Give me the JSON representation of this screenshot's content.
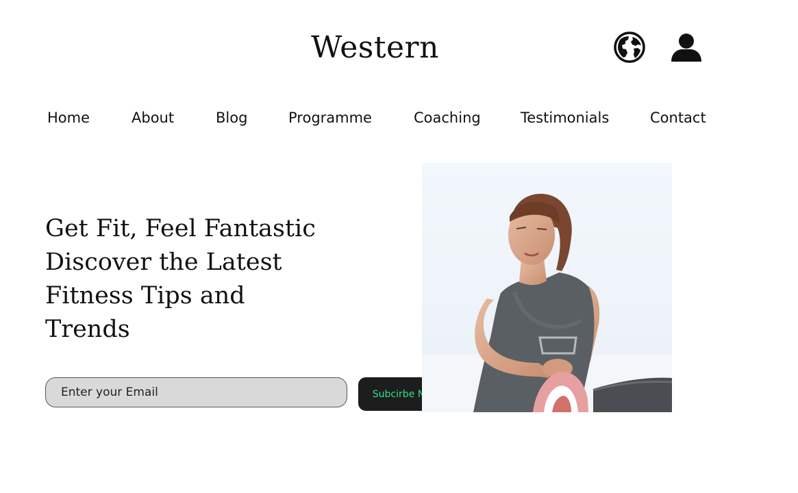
{
  "header": {
    "brand": "Western",
    "icons": [
      "globe-icon",
      "user-icon"
    ]
  },
  "nav": {
    "items": [
      {
        "label": "Home"
      },
      {
        "label": "About"
      },
      {
        "label": "Blog"
      },
      {
        "label": "Programme"
      },
      {
        "label": "Coaching"
      },
      {
        "label": "Testimonials"
      },
      {
        "label": "Contact"
      }
    ]
  },
  "hero": {
    "headline_lines": [
      "Get Fit, Feel Fantastic",
      "Discover the Latest",
      "Fitness Tips and",
      "Trends"
    ],
    "email_placeholder": "Enter your Email",
    "email_value": "",
    "subscribe_label": "Subcirbe Now",
    "image": "woman-stretching-photo"
  },
  "colors": {
    "button_bg": "#1d1d1d",
    "button_text": "#2fe08a",
    "input_bg": "#d9d9d9"
  }
}
